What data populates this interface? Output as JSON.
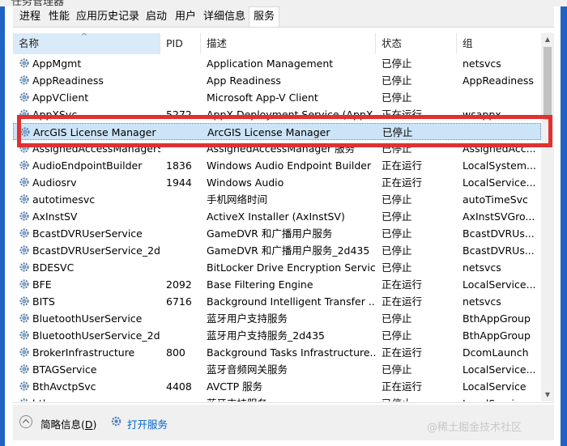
{
  "title_strip": "任务管理器",
  "tabs": [
    "进程",
    "性能",
    "应用历史记录",
    "启动",
    "用户",
    "详细信息",
    "服务"
  ],
  "selected_tab": "服务",
  "columns": {
    "name": "名称",
    "pid": "PID",
    "desc": "描述",
    "status": "状态",
    "group": "组"
  },
  "sort_indicator": "^",
  "rows": [
    {
      "name": "AppMgmt",
      "pid": "",
      "desc": "Application Management",
      "status": "已停止",
      "group": "netsvcs"
    },
    {
      "name": "AppReadiness",
      "pid": "",
      "desc": "App Readiness",
      "status": "已停止",
      "group": "AppReadiness"
    },
    {
      "name": "AppVClient",
      "pid": "",
      "desc": "Microsoft App-V Client",
      "status": "已停止",
      "group": ""
    },
    {
      "name": "AppXSvc",
      "pid": "5272",
      "desc": "AppX Deployment Service (AppX...",
      "status": "正在运行",
      "group": "wsappx"
    },
    {
      "name": "ArcGIS License Manager",
      "pid": "",
      "desc": "ArcGIS License Manager",
      "status": "已停止",
      "group": ""
    },
    {
      "name": "AssignedAccessManagerSvc",
      "pid": "",
      "desc": "AssignedAccessManager 服务",
      "status": "已停止",
      "group": "AssignedAcc..."
    },
    {
      "name": "AudioEndpointBuilder",
      "pid": "1836",
      "desc": "Windows Audio Endpoint Builder",
      "status": "正在运行",
      "group": "LocalSystem..."
    },
    {
      "name": "Audiosrv",
      "pid": "1944",
      "desc": "Windows Audio",
      "status": "正在运行",
      "group": "LocalService..."
    },
    {
      "name": "autotimesvc",
      "pid": "",
      "desc": "手机网络时间",
      "status": "已停止",
      "group": "autoTimeSvc"
    },
    {
      "name": "AxInstSV",
      "pid": "",
      "desc": "ActiveX Installer (AxInstSV)",
      "status": "已停止",
      "group": "AxInstSVGro..."
    },
    {
      "name": "BcastDVRUserService",
      "pid": "",
      "desc": "GameDVR 和广播用户服务",
      "status": "已停止",
      "group": "BcastDVRUs..."
    },
    {
      "name": "BcastDVRUserService_2d...",
      "pid": "",
      "desc": "GameDVR 和广播用户服务_2d435",
      "status": "已停止",
      "group": "BcastDVRUs..."
    },
    {
      "name": "BDESVC",
      "pid": "",
      "desc": "BitLocker Drive Encryption Service",
      "status": "已停止",
      "group": "netsvcs"
    },
    {
      "name": "BFE",
      "pid": "2092",
      "desc": "Base Filtering Engine",
      "status": "正在运行",
      "group": "LocalService..."
    },
    {
      "name": "BITS",
      "pid": "6716",
      "desc": "Background Intelligent Transfer ...",
      "status": "正在运行",
      "group": "netsvcs"
    },
    {
      "name": "BluetoothUserService",
      "pid": "",
      "desc": "蓝牙用户支持服务",
      "status": "已停止",
      "group": "BthAppGroup"
    },
    {
      "name": "BluetoothUserService_2d...",
      "pid": "",
      "desc": "蓝牙用户支持服务_2d435",
      "status": "已停止",
      "group": "BthAppGroup"
    },
    {
      "name": "BrokerInfrastructure",
      "pid": "800",
      "desc": "Background Tasks Infrastructure...",
      "status": "正在运行",
      "group": "DcomLaunch"
    },
    {
      "name": "BTAGService",
      "pid": "",
      "desc": "蓝牙音频网关服务",
      "status": "已停止",
      "group": "LocalService..."
    },
    {
      "name": "BthAvctpSvc",
      "pid": "4408",
      "desc": "AVCTP 服务",
      "status": "正在运行",
      "group": "LocalService"
    },
    {
      "name": "bthserv",
      "pid": "",
      "desc": "蓝牙支持服务",
      "status": "已停止",
      "group": "LocalService"
    }
  ],
  "selected_row": 4,
  "footer": {
    "less_details": "简略信息",
    "less_details_key": "D",
    "open_services": "打开服务"
  },
  "watermark": "@稀土掘金技术社区",
  "colors": {
    "selected_row": "#cce4f7",
    "highlight_box": "#e03131",
    "link": "#0066cc",
    "desktop": "#1f63c4"
  }
}
